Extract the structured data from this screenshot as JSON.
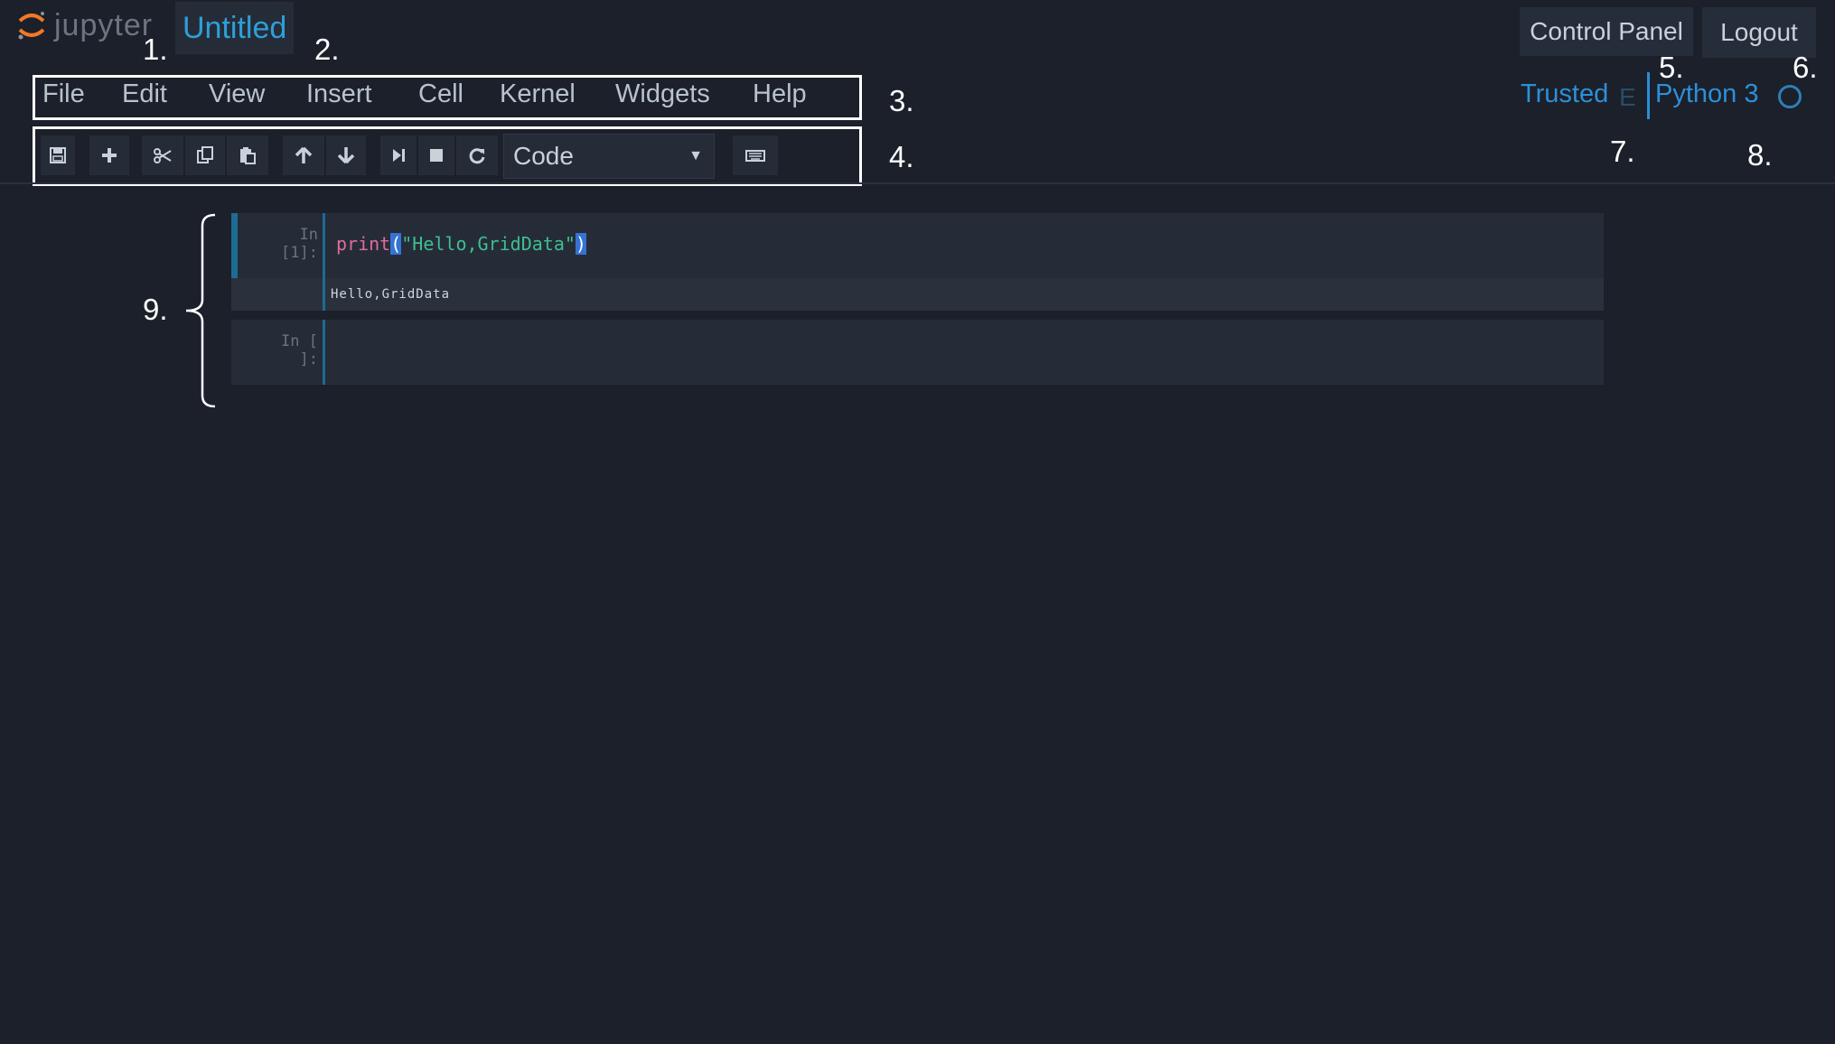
{
  "header": {
    "logo_text": "jupyter",
    "notebook_title": "Untitled",
    "control_panel_label": "Control Panel",
    "logout_label": "Logout"
  },
  "menubar": {
    "items": [
      "File",
      "Edit",
      "View",
      "Insert",
      "Cell",
      "Kernel",
      "Widgets",
      "Help"
    ]
  },
  "toolbar": {
    "buttons": [
      "save-icon",
      "plus-icon",
      "cut-icon",
      "copy-icon",
      "paste-icon",
      "arrow-up-icon",
      "arrow-down-icon",
      "run-step-icon",
      "stop-icon",
      "restart-icon",
      "keyboard-icon"
    ],
    "cell_type": "Code"
  },
  "kernel": {
    "trusted_label": "Trusted",
    "edit_indicator": "E",
    "name": "Python 3"
  },
  "annotations": {
    "n1": "1.",
    "n2": "2.",
    "n3": "3.",
    "n4": "4.",
    "n5": "5.",
    "n6": "6.",
    "n7": "7.",
    "n8": "8.",
    "n9": "9."
  },
  "cells": [
    {
      "prompt": "In [1]:",
      "code_fn": "print",
      "code_open": "(",
      "code_str": "\"Hello,GridData\"",
      "code_close": ")",
      "output": "Hello,GridData"
    },
    {
      "prompt": "In [ ]:"
    }
  ],
  "colors": {
    "background": "#1b202a",
    "accent": "#2e9fd8",
    "logo_orange": "#f37726"
  }
}
